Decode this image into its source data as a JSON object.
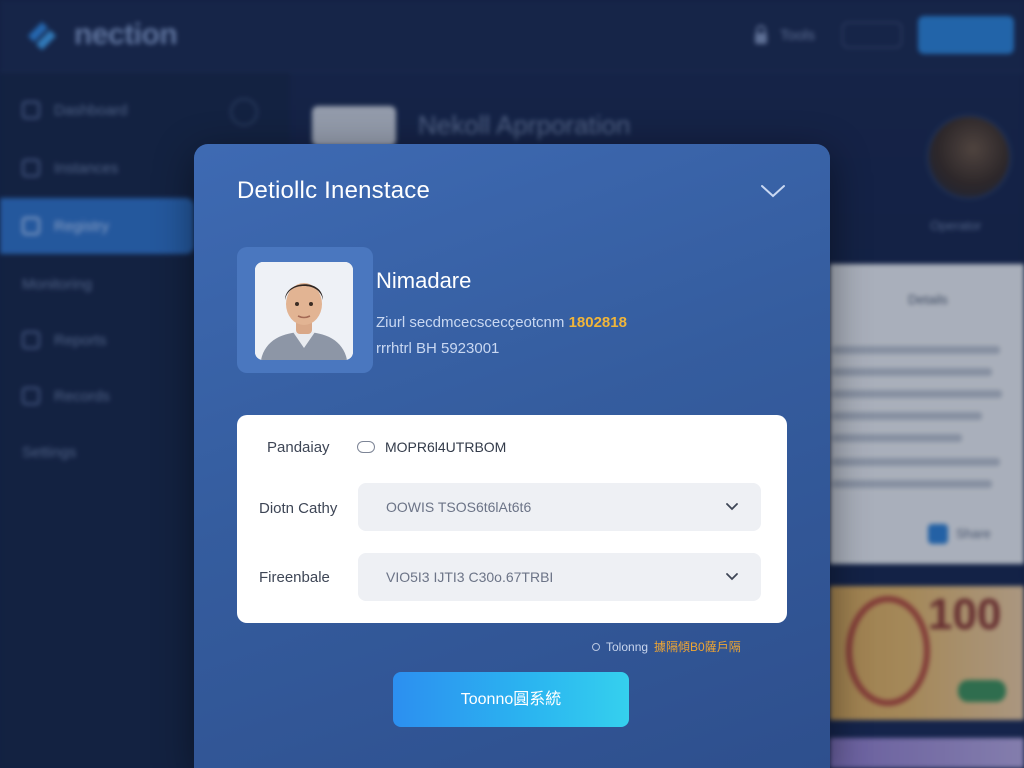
{
  "app": {
    "brand": "nection",
    "topnav": {
      "label": "Tools",
      "pill": "",
      "cta": ""
    },
    "sidebar": {
      "items": [
        {
          "label": "Dashboard"
        },
        {
          "label": "Instances"
        },
        {
          "label": "Registry"
        },
        {
          "label": "Monitoring"
        },
        {
          "label": "Reports"
        },
        {
          "label": "Records"
        },
        {
          "label": "Settings"
        }
      ]
    },
    "content": {
      "title": "Nekoll Aprporation"
    },
    "profile": {
      "caption": "Operator"
    },
    "doc_panel": {
      "header": "Details",
      "footer_label": "Share"
    },
    "banknote": {
      "value": "100"
    }
  },
  "modal": {
    "title": "Detiollc Inenstace",
    "identity": {
      "name": "Nimadare",
      "line1_text": "Ziurl secdmcecscecçeotcnm",
      "line1_highlight": "1802818",
      "line2_text": "rrrhtrl BH 5923001"
    },
    "form": {
      "rows": [
        {
          "label": "Pandaiay",
          "kind": "radio",
          "value": "MOPR6l4UTRBOM"
        },
        {
          "label": "Diotn Cathy",
          "kind": "select",
          "value": "OOWIS TSOS6t6lAt6t6"
        },
        {
          "label": "Fireenbale",
          "kind": "select",
          "value": "VIO5I3 IJTI3 C30o.67TRBI"
        }
      ]
    },
    "footnote": {
      "label": "Tolonng",
      "accent": "據隔傾B0薩戶隔"
    },
    "primary_button": "Toonno圓系統"
  },
  "colors": {
    "modal_bg": "#3a64ad",
    "accent_orange": "#f0b53a",
    "button_blue": "#2bb6f0",
    "sidebar_active": "#2f72c8"
  },
  "icons": {
    "modal_toggle": "chevron-down-icon",
    "select_chevron": "chevron-down-icon",
    "brand": "logo-icon"
  }
}
